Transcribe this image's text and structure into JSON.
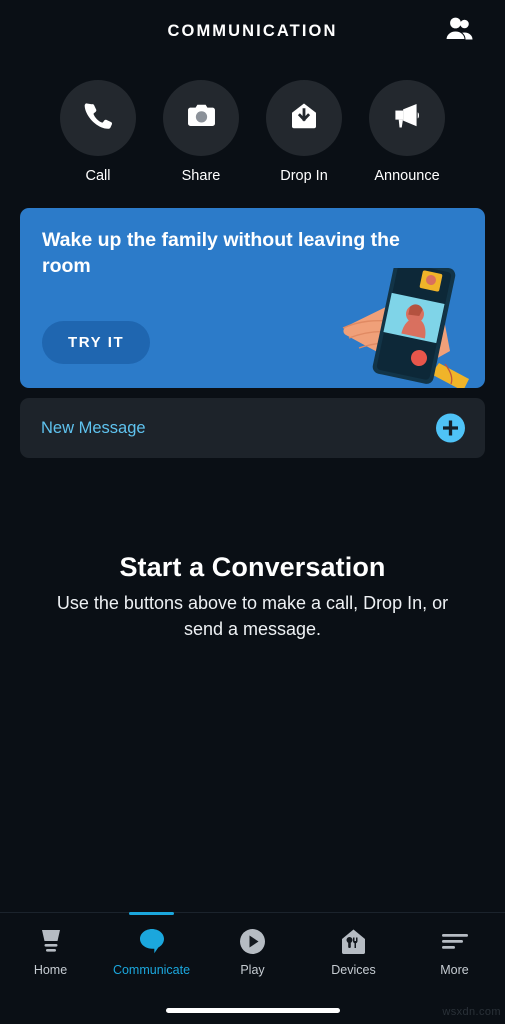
{
  "header": {
    "title": "COMMUNICATION",
    "contacts_icon": "contacts-people-icon"
  },
  "quick_actions": [
    {
      "label": "Call",
      "icon": "phone-icon"
    },
    {
      "label": "Share",
      "icon": "camera-icon"
    },
    {
      "label": "Drop In",
      "icon": "drop-in-house-arrow-icon"
    },
    {
      "label": "Announce",
      "icon": "megaphone-icon"
    }
  ],
  "promo": {
    "title": "Wake up the family without leaving the room",
    "cta_label": "TRY IT",
    "illustration": "hand-holding-phone-video-call-illustration",
    "bg_color": "#2c7bc9",
    "cta_color": "#1f66b0"
  },
  "new_message": {
    "label": "New Message",
    "add_icon": "plus-circle-icon",
    "accent_color": "#5fc3ef"
  },
  "empty_state": {
    "title": "Start a Conversation",
    "subtitle": "Use the buttons above to make a call, Drop In, or send a message."
  },
  "bottom_nav": {
    "active_color": "#1ba7dd",
    "inactive_color": "#c6ccd2",
    "items": [
      {
        "label": "Home",
        "icon": "home-echo-icon",
        "active": false
      },
      {
        "label": "Communicate",
        "icon": "speech-bubble-icon",
        "active": true
      },
      {
        "label": "Play",
        "icon": "play-circle-icon",
        "active": false
      },
      {
        "label": "Devices",
        "icon": "devices-house-icon",
        "active": false
      },
      {
        "label": "More",
        "icon": "hamburger-more-icon",
        "active": false
      }
    ]
  },
  "watermark": "wsxdn.com"
}
